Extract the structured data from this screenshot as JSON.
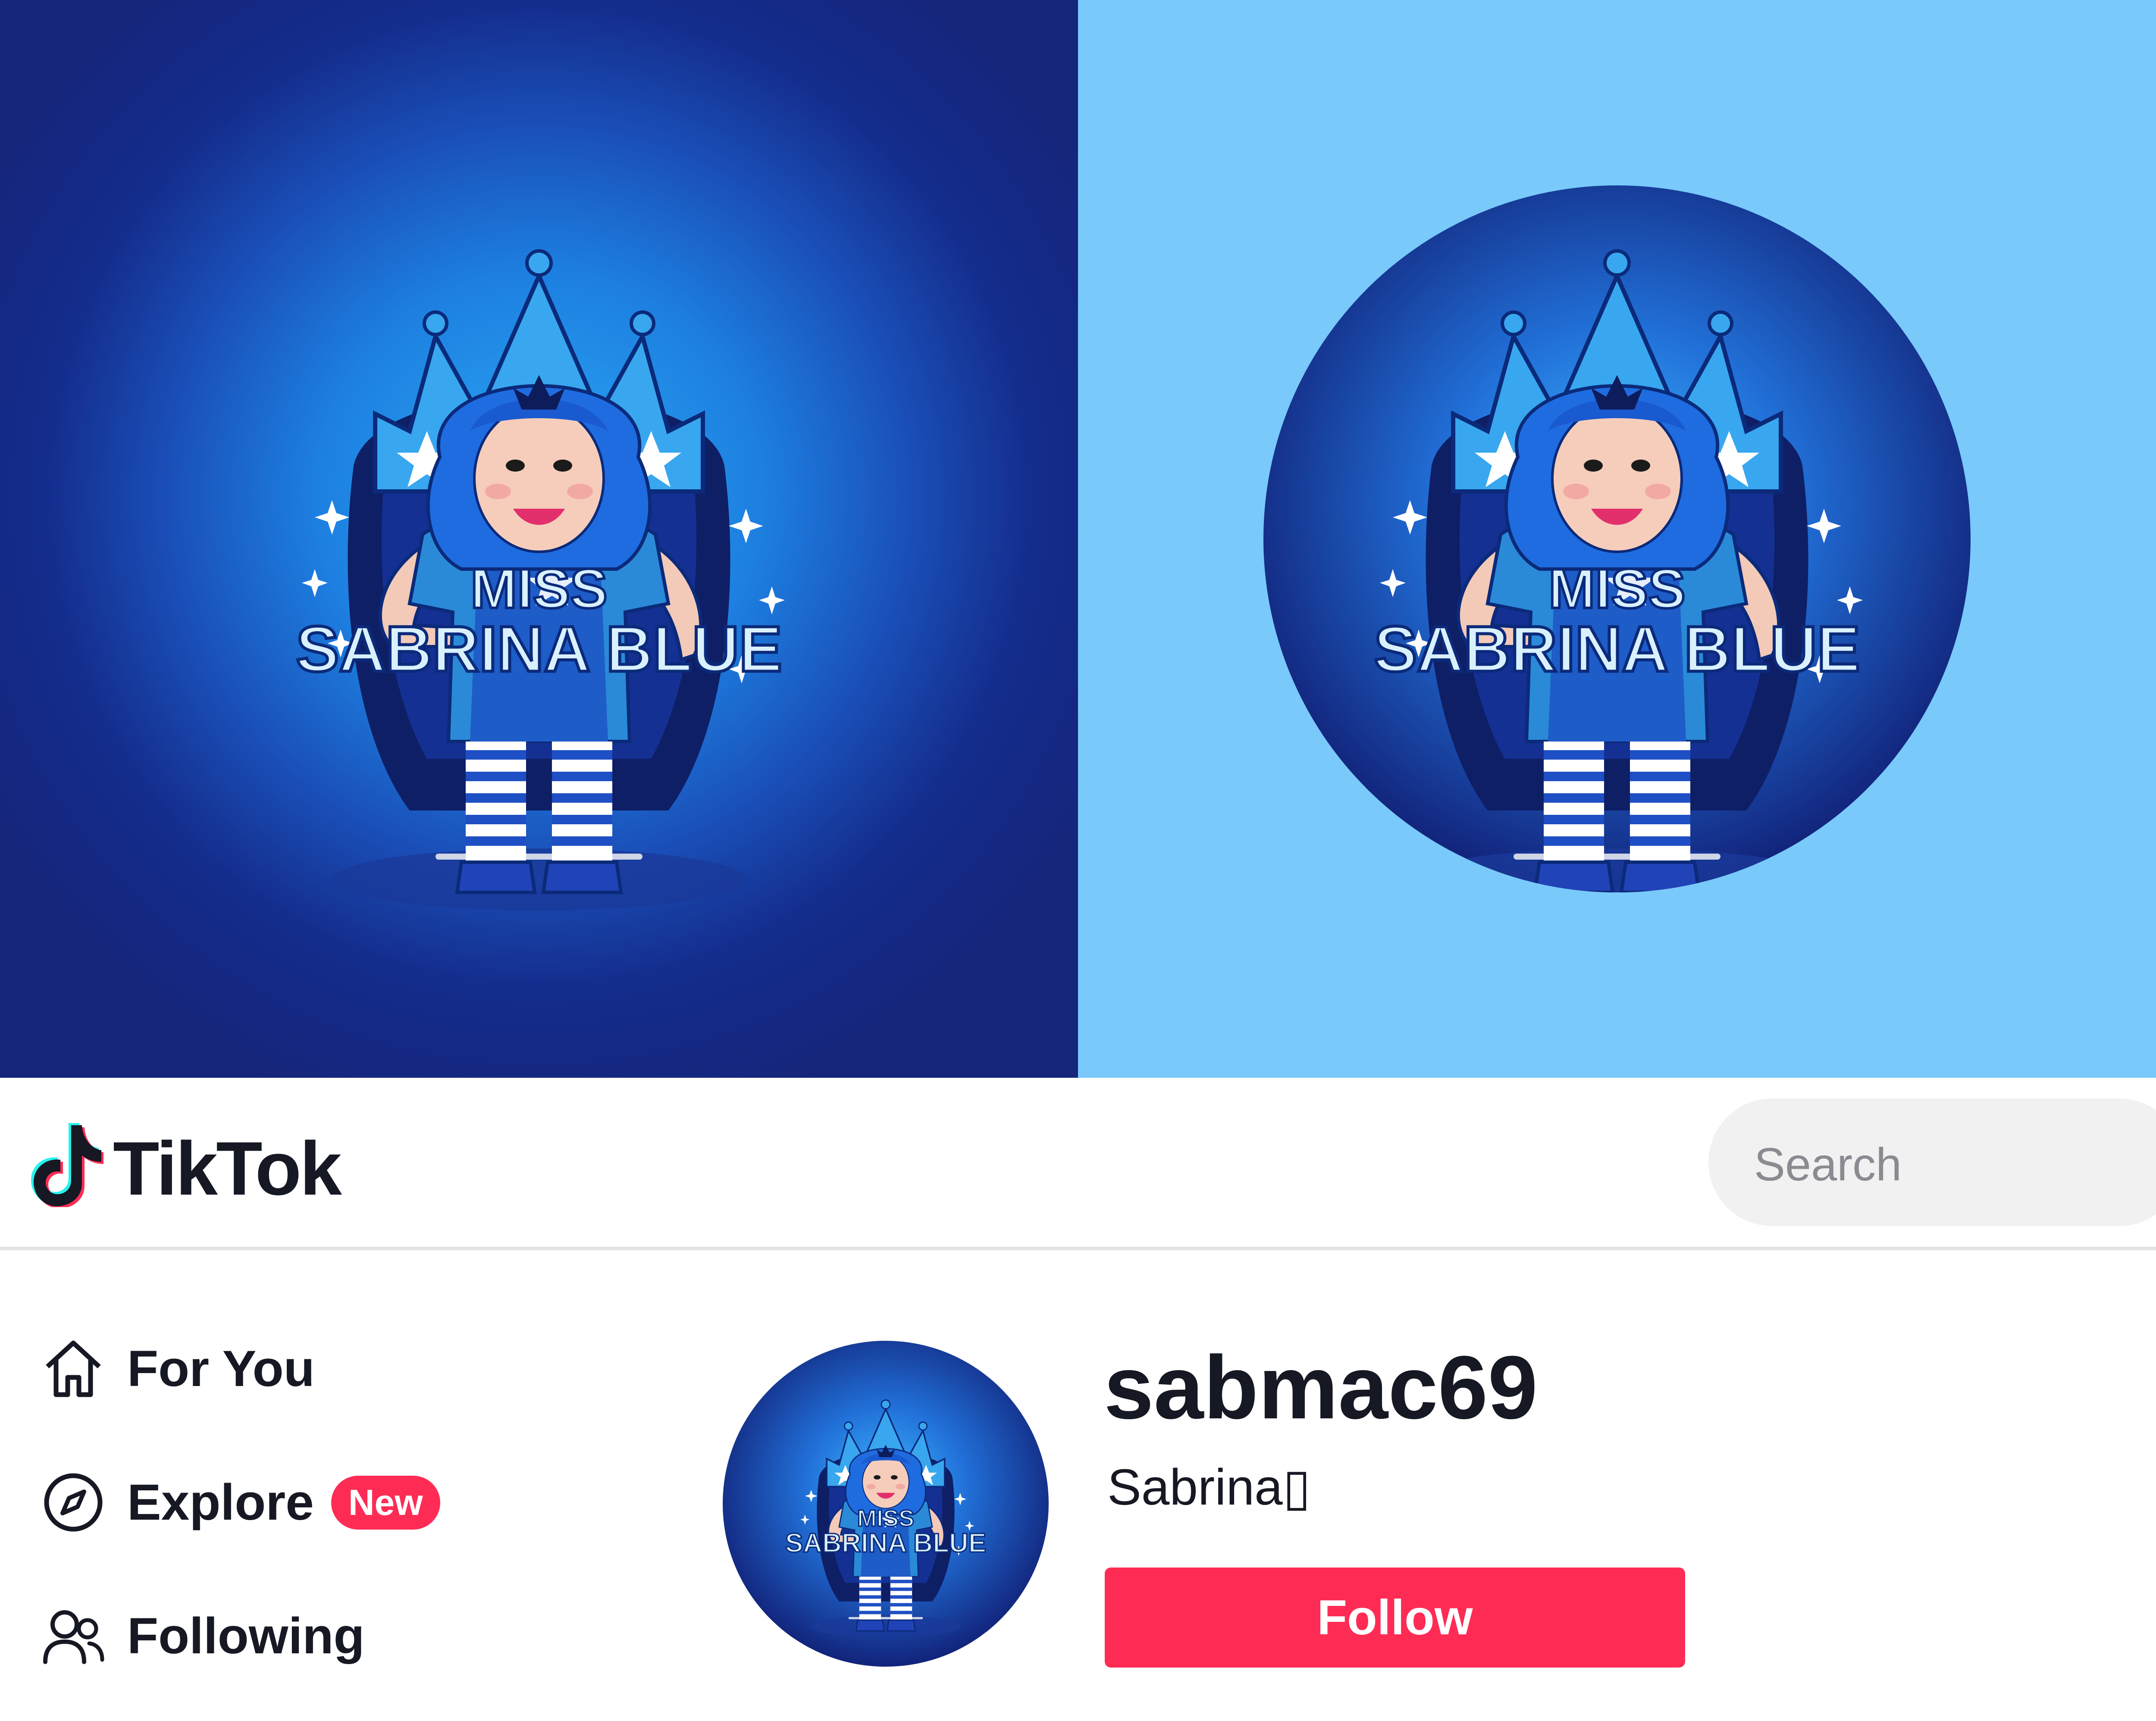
{
  "artwork": {
    "title_line1": "MISS",
    "title_line2": "SABRINA BLUE",
    "left_background": "#15257a",
    "right_background": "#79c9fb"
  },
  "header": {
    "logo_text": "TikTok",
    "search_placeholder": "Search"
  },
  "sidebar": {
    "items": [
      {
        "label": "For You",
        "icon": "home-icon"
      },
      {
        "label": "Explore",
        "icon": "compass-icon",
        "badge": "New"
      },
      {
        "label": "Following",
        "icon": "users-icon"
      }
    ]
  },
  "profile": {
    "username": "sabmac69",
    "display_name": "Sabrina▯",
    "follow_label": "Follow",
    "accent": "#fe2c55"
  }
}
